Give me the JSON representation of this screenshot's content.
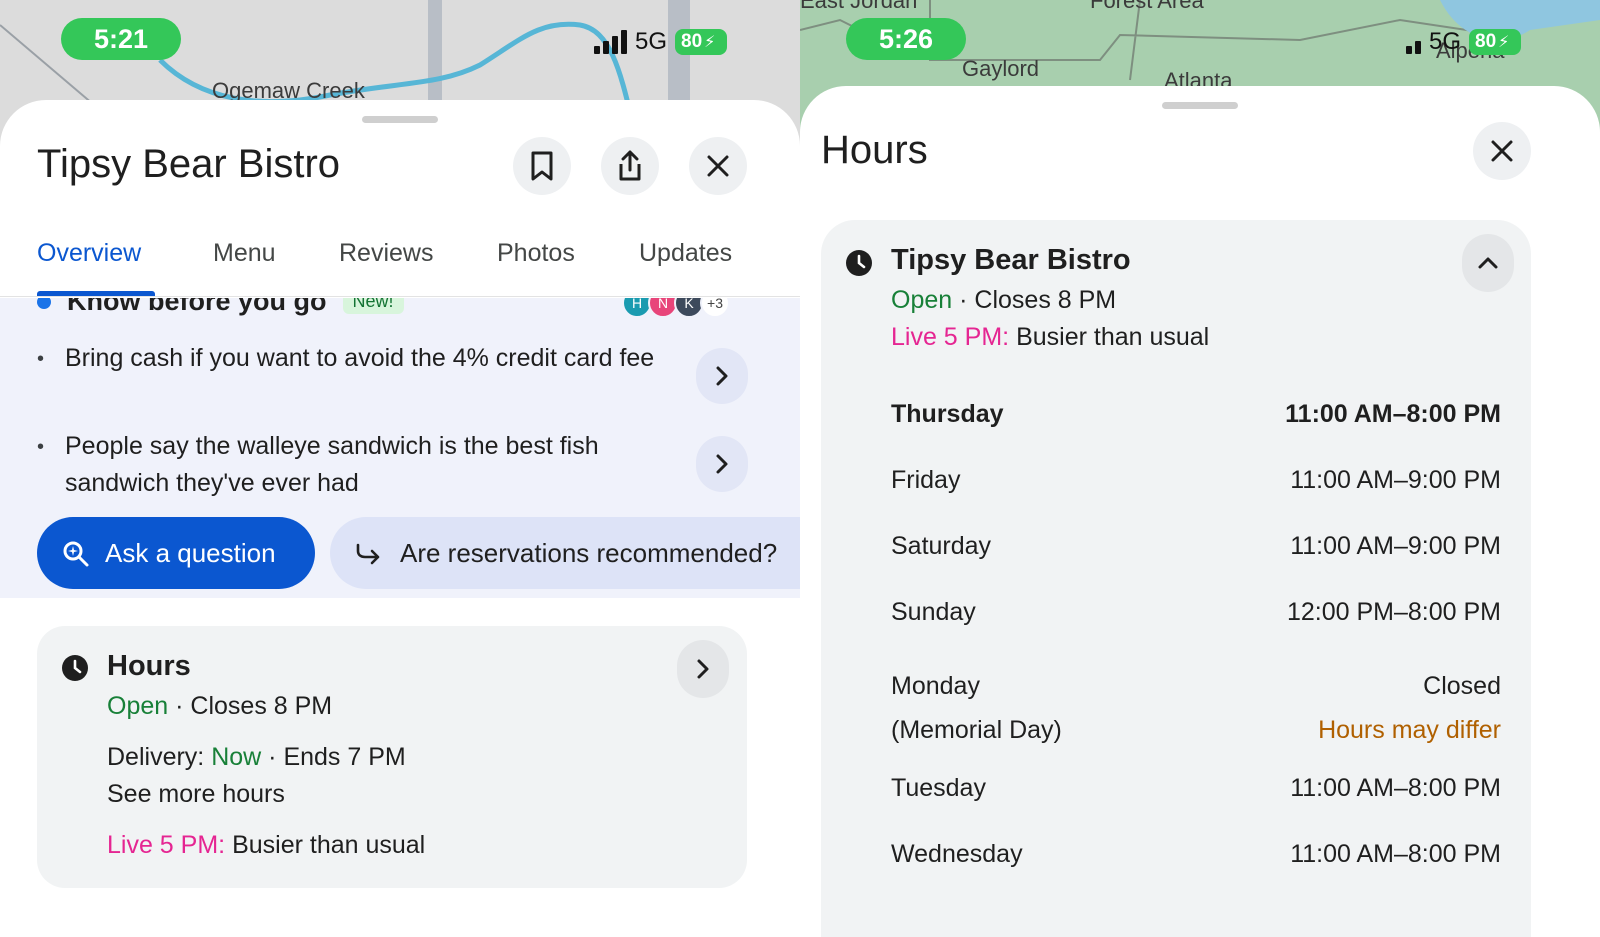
{
  "left": {
    "status": {
      "time": "5:21",
      "network": "5G",
      "battery": "80"
    },
    "map": {
      "label": "Ogemaw Creek"
    },
    "place_title": "Tipsy Bear Bistro",
    "actions": {
      "save_icon": "bookmark-icon",
      "share_icon": "share-icon",
      "close_icon": "close-icon"
    },
    "tabs": [
      {
        "label": "Overview",
        "active": true
      },
      {
        "label": "Menu"
      },
      {
        "label": "Reviews"
      },
      {
        "label": "Photos"
      },
      {
        "label": "Updates"
      }
    ],
    "know_before": {
      "title": "Know before you go",
      "badge": "New!",
      "avatars": [
        "H",
        "N",
        "K"
      ],
      "more_count": "+3",
      "tips": [
        "Bring cash if you want to avoid the 4% credit card fee",
        "People say the walleye sandwich is the best fish sandwich they've ever had"
      ]
    },
    "ask_button": "Ask a question",
    "suggestion_chip": "Are reservations recommended?",
    "hours_card": {
      "title": "Hours",
      "open": "Open",
      "closes": "Closes 8 PM",
      "delivery_label": "Delivery:",
      "delivery_now": "Now",
      "delivery_ends": "Ends 7 PM",
      "see_more": "See more hours",
      "live_label": "Live 5 PM:",
      "live_text": "Busier than usual"
    }
  },
  "right": {
    "status": {
      "time": "5:26",
      "network": "5G",
      "battery": "80"
    },
    "map": {
      "labels": [
        "East Jordan",
        "Forest Area",
        "Gaylord",
        "Atlanta",
        "Alpena"
      ]
    },
    "sheet_title": "Hours",
    "card": {
      "name": "Tipsy Bear Bistro",
      "open": "Open",
      "closes": "Closes 8 PM",
      "live_label": "Live 5 PM:",
      "live_text": "Busier than usual",
      "days": [
        {
          "day": "Thursday",
          "hours": "11:00 AM–8:00 PM",
          "today": true
        },
        {
          "day": "Friday",
          "hours": "11:00 AM–9:00 PM"
        },
        {
          "day": "Saturday",
          "hours": "11:00 AM–9:00 PM"
        },
        {
          "day": "Sunday",
          "hours": "12:00 PM–8:00 PM"
        },
        {
          "day": "Monday",
          "day_note": "(Memorial Day)",
          "hours": "Closed",
          "hours_note": "Hours may differ"
        },
        {
          "day": "Tuesday",
          "hours": "11:00 AM–8:00 PM"
        },
        {
          "day": "Wednesday",
          "hours": "11:00 AM–8:00 PM"
        }
      ]
    }
  },
  "colors": {
    "accent_blue": "#0b57d0",
    "open_green": "#188038",
    "live_magenta": "#e52592",
    "warning_orange": "#b06000",
    "status_green": "#34c759"
  }
}
